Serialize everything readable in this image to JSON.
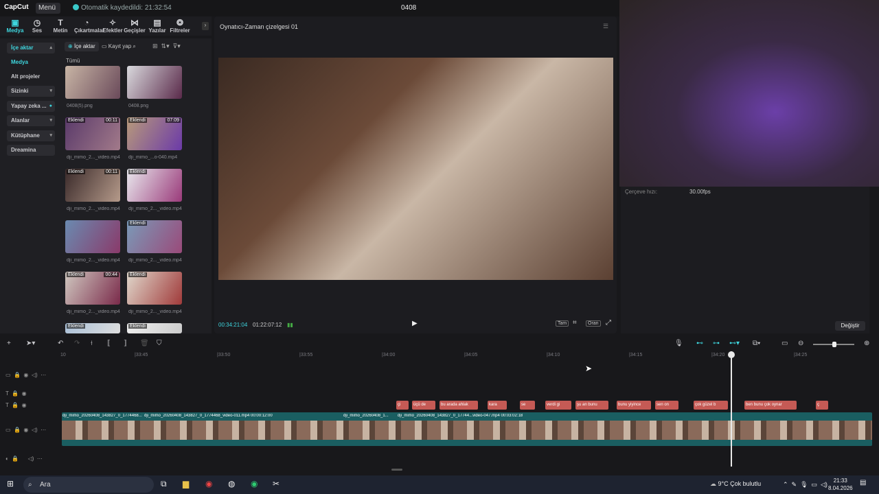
{
  "app": {
    "logo": "CapCut",
    "menu": "Menü",
    "saved_status": "Otomatik kaydedildi: 21:32:54",
    "project_title": "0408"
  },
  "toolbar": {
    "tabs": [
      {
        "label": "Medya",
        "icon": "media-icon"
      },
      {
        "label": "Ses",
        "icon": "audio-icon"
      },
      {
        "label": "Metin",
        "icon": "text-icon"
      },
      {
        "label": "Çıkartmalar",
        "icon": "sticker-icon"
      },
      {
        "label": "Efektler",
        "icon": "effects-icon"
      },
      {
        "label": "Geçişler",
        "icon": "transition-icon"
      },
      {
        "label": "Yazılar",
        "icon": "captions-icon"
      },
      {
        "label": "Filtreler",
        "icon": "filter-icon"
      }
    ]
  },
  "sidebar": {
    "items": [
      {
        "label": "İçe aktar"
      },
      {
        "label": "Medya"
      },
      {
        "label": "Alt projeler"
      },
      {
        "label": "Sizinki"
      },
      {
        "label": "Yapay zeka ..."
      },
      {
        "label": "Alanlar"
      },
      {
        "label": "Kütüphane"
      },
      {
        "label": "Dreamina"
      }
    ]
  },
  "media": {
    "import_label": "İçe aktar",
    "record_label": "Kayıt yap",
    "filter_label": "Tümü",
    "items": [
      {
        "name": "0408(5).png",
        "badge": "",
        "duration": ""
      },
      {
        "name": "0408.png",
        "badge": "",
        "duration": ""
      },
      {
        "name": "dji_mimo_2..._video.mp4",
        "badge": "Eklendi",
        "duration": "00:11"
      },
      {
        "name": "dji_mimo_...o-040.mp4",
        "badge": "Eklendi",
        "duration": "07:09"
      },
      {
        "name": "dji_mimo_2..._video.mp4",
        "badge": "Eklendi",
        "duration": "00:11"
      },
      {
        "name": "dji_mimo_2..._video.mp4",
        "badge": "Eklendi",
        "duration": ""
      },
      {
        "name": "dji_mimo_2..._video.mp4",
        "badge": "",
        "duration": ""
      },
      {
        "name": "dji_mimo_2..._video.mp4",
        "badge": "Eklendi",
        "duration": ""
      },
      {
        "name": "dji_mimo_2..._video.mp4",
        "badge": "Eklendi",
        "duration": "00:44"
      },
      {
        "name": "dji_mimo_2..._video.mp4",
        "badge": "Eklendi",
        "duration": ""
      },
      {
        "name": "",
        "badge": "Eklendi",
        "duration": ""
      },
      {
        "name": "",
        "badge": "Eklendi",
        "duration": ""
      }
    ]
  },
  "player": {
    "title": "Oynatıcı-Zaman çizelgesi 01",
    "current_time": "00:34:21:04",
    "total_time": "01:22:07:12",
    "full_label": "Tam",
    "ratio_label": "Oran"
  },
  "details": {
    "frame_rate_label": "Çerçeve hızı:",
    "frame_rate_value": "30.00fps",
    "change_button": "Değiştir"
  },
  "timeline": {
    "ruler": [
      "10",
      "|33:45",
      "|33:50",
      "|33:55",
      "|34:00",
      "|34:05",
      "|34:10",
      "|34:15",
      "|34:20",
      "|34:25"
    ],
    "text_clips": [
      "çi",
      "üçü de",
      "bu arada ahlak",
      "kara",
      "se",
      "verdi gi",
      "şu an bunu",
      "bunu yiyince",
      "sen on",
      "çok güzel b",
      "ben bunu çok oynar",
      "ç"
    ],
    "video_clips": [
      "dji_mimo_20260408_143827_0_1774468...video-0",
      "dji_mimo_20260408_143827_0_1774468_video-011.mp4 00:00:12:00",
      "dji_mimo_20260408_1...",
      "dji_mimo_20260408_143827_0_17744...video-047.mp4 00:03:02:18"
    ]
  },
  "taskbar": {
    "search_placeholder": "Ara",
    "weather": "9°C Çok bulutlu",
    "time": "21:33",
    "date": "8.04.2026"
  }
}
